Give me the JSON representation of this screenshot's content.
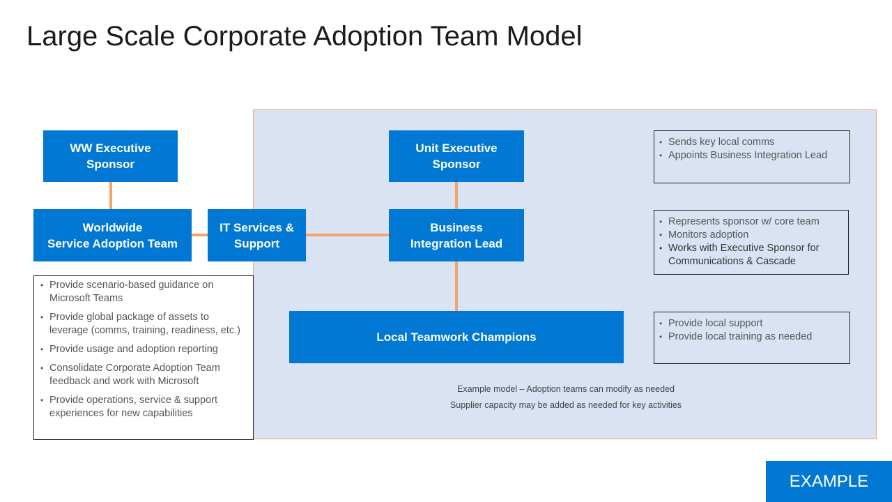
{
  "title": "Large Scale Corporate Adoption Team Model",
  "nodes": {
    "ww_exec": "WW Executive\nSponsor",
    "ww_team": "Worldwide\nService Adoption Team",
    "it_services": "IT Services &\nSupport",
    "unit_exec": "Unit Executive\nSponsor",
    "bil": "Business\nIntegration Lead",
    "champions": "Local Teamwork Champions"
  },
  "ww_team_notes": [
    "Provide scenario-based guidance on Microsoft Teams",
    "Provide global package of assets to leverage (comms, training, readiness, etc.)",
    "Provide usage and adoption reporting",
    "Consolidate Corporate Adoption Team feedback and work with Microsoft",
    "Provide operations, service & support experiences for new capabilities"
  ],
  "unit_exec_notes": [
    "Sends key local comms",
    "Appoints Business Integration Lead"
  ],
  "bil_notes": [
    "Represents sponsor w/ core team",
    "Monitors adoption",
    "Works with Executive Sponsor for Communications & Cascade"
  ],
  "champions_notes": [
    "Provide local support",
    "Provide local training as needed"
  ],
  "captions": [
    "Example model – Adoption teams can modify as needed",
    "Supplier capacity may be added as needed for key activities"
  ],
  "badge": "EXAMPLE",
  "colors": {
    "node_blue": "#0078d4",
    "connector_orange": "#f4a46a",
    "panel_bg": "#dae3f3"
  }
}
